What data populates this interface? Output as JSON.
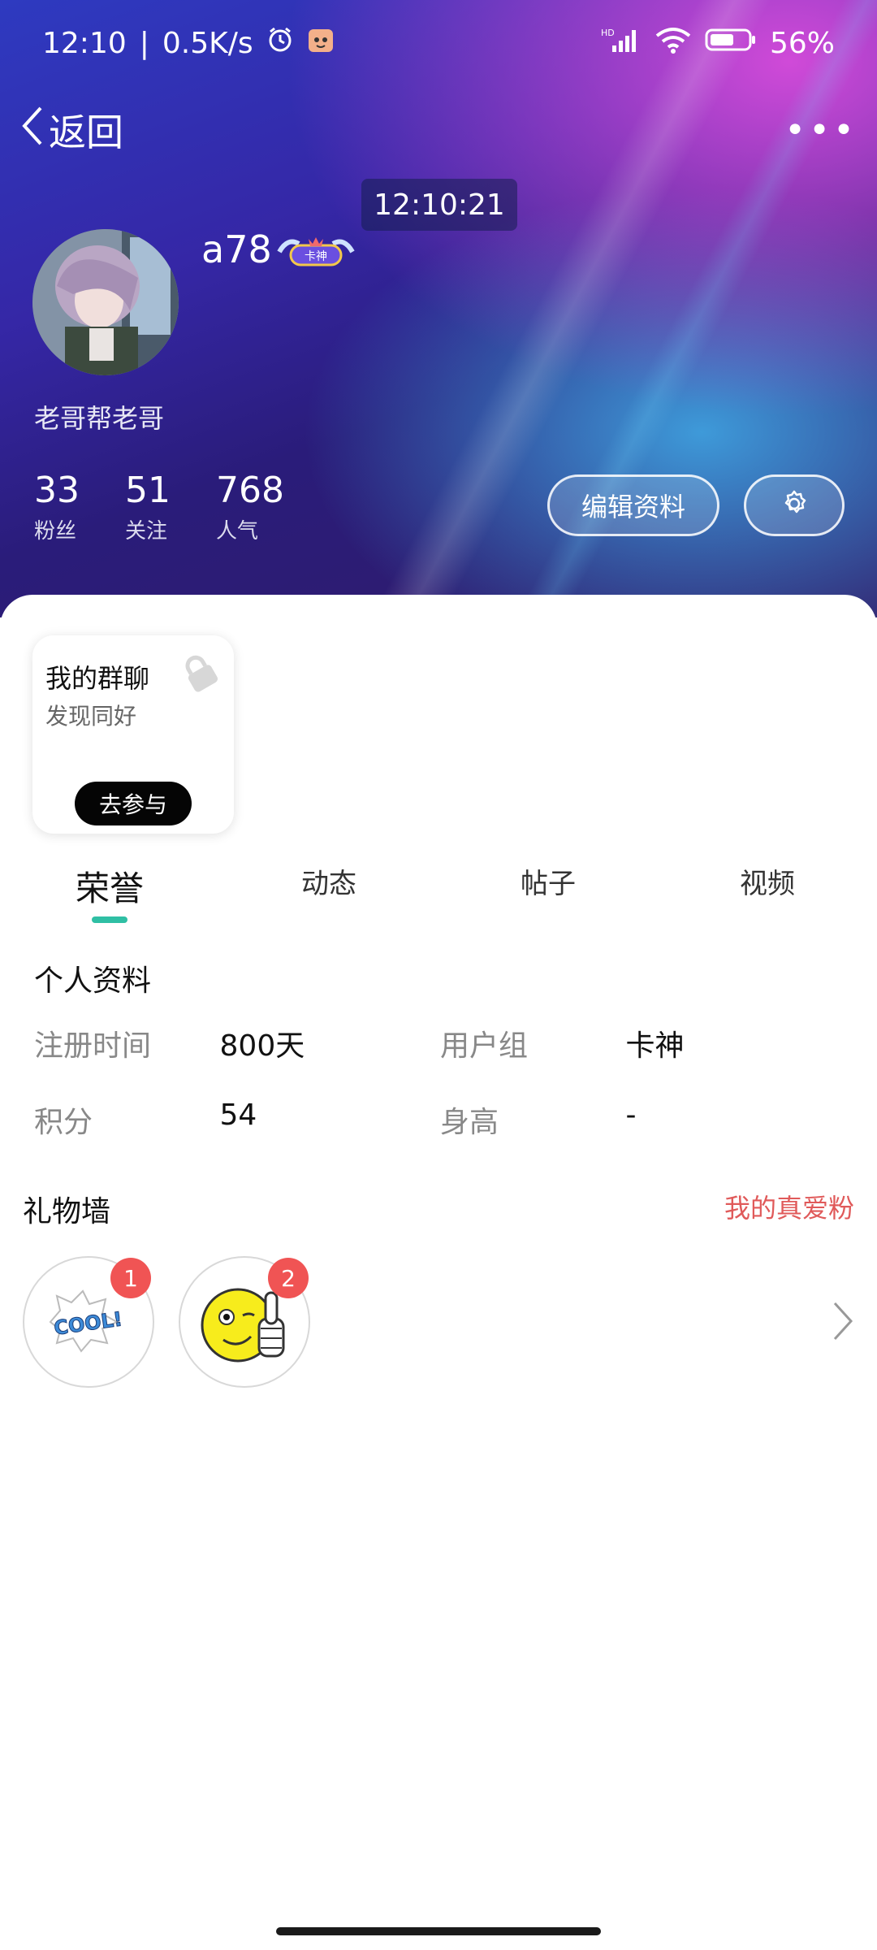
{
  "status_bar": {
    "time": "12:10",
    "net_speed": "0.5K/s",
    "signal": "HD",
    "battery": "56%"
  },
  "header": {
    "back_label": "返回",
    "more_label": "•••",
    "time_chip": "12:10:21"
  },
  "profile": {
    "username": "a78",
    "badge_text": "卡神",
    "signature": "老哥帮老哥",
    "stats": [
      {
        "value": "33",
        "label": "粉丝"
      },
      {
        "value": "51",
        "label": "关注"
      },
      {
        "value": "768",
        "label": "人气"
      }
    ],
    "edit_button": "编辑资料"
  },
  "group_card": {
    "title": "我的群聊",
    "subtitle": "发现同好",
    "button": "去参与"
  },
  "tabs": [
    {
      "label": "荣誉",
      "active": true
    },
    {
      "label": "动态",
      "active": false
    },
    {
      "label": "帖子",
      "active": false
    },
    {
      "label": "视频",
      "active": false
    }
  ],
  "personal_info": {
    "title": "个人资料",
    "rows": [
      {
        "k1": "注册时间",
        "v1": "800天",
        "k2": "用户组",
        "v2": "卡神"
      },
      {
        "k1": "积分",
        "v1": "54",
        "k2": "身高",
        "v2": "-"
      }
    ]
  },
  "gift_wall": {
    "title": "礼物墙",
    "link": "我的真爱粉",
    "gifts": [
      {
        "name": "cool-sticker",
        "count": "1",
        "text": "COOL!"
      },
      {
        "name": "thumbs-up-smiley",
        "count": "2"
      }
    ]
  },
  "colors": {
    "accent_tab": "#2fbfa4",
    "link_red": "#e05a5a",
    "badge_red": "#f05454"
  }
}
